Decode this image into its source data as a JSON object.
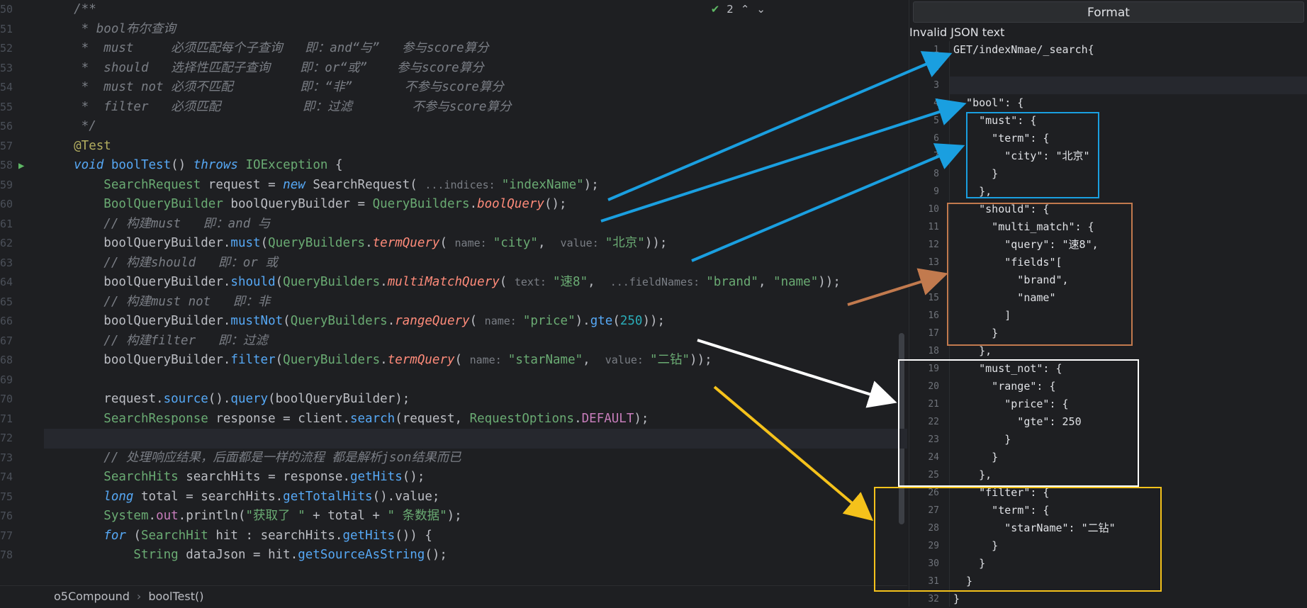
{
  "editor": {
    "inspection_count": "2",
    "lines": [
      {
        "n": "50",
        "tokens": [
          {
            "c": "tok-comment",
            "t": "    /**"
          }
        ]
      },
      {
        "n": "51",
        "tokens": [
          {
            "c": "tok-comment",
            "t": "     * bool布尔查询"
          }
        ]
      },
      {
        "n": "52",
        "tokens": [
          {
            "c": "tok-comment",
            "t": "     *  must     必须匹配每个子查询   即：and“与”   参与score算分"
          }
        ]
      },
      {
        "n": "53",
        "tokens": [
          {
            "c": "tok-comment",
            "t": "     *  should   选择性匹配子查询    即：or“或”    参与score算分"
          }
        ]
      },
      {
        "n": "54",
        "tokens": [
          {
            "c": "tok-comment",
            "t": "     *  must not 必须不匹配         即：“非”       不参与score算分"
          }
        ]
      },
      {
        "n": "55",
        "tokens": [
          {
            "c": "tok-comment",
            "t": "     *  filter   必须匹配           即：过滤        不参与score算分"
          }
        ]
      },
      {
        "n": "56",
        "tokens": [
          {
            "c": "tok-comment",
            "t": "     */"
          }
        ]
      },
      {
        "n": "57",
        "tokens": [
          {
            "c": "tok-ann",
            "t": "    @Test"
          }
        ]
      },
      {
        "n": "58",
        "tokens": [
          {
            "c": "tok-type tok-it",
            "t": "    void "
          },
          {
            "c": "tok-method",
            "t": "boolTest"
          },
          {
            "c": "",
            "t": "() "
          },
          {
            "c": "tok-type tok-it",
            "t": "throws "
          },
          {
            "c": "tok-class",
            "t": "IOException"
          },
          {
            "c": "",
            "t": " {"
          }
        ]
      },
      {
        "n": "59",
        "tokens": [
          {
            "c": "tok-class",
            "t": "        SearchRequest"
          },
          {
            "c": "",
            "t": " request = "
          },
          {
            "c": "tok-type tok-it",
            "t": "new "
          },
          {
            "c": "",
            "t": "SearchRequest( "
          },
          {
            "c": "tok-hint",
            "t": "...indices: "
          },
          {
            "c": "tok-str",
            "t": "\"indexName\""
          },
          {
            "c": "",
            "t": ");"
          }
        ]
      },
      {
        "n": "60",
        "tokens": [
          {
            "c": "tok-class",
            "t": "        BoolQueryBuilder"
          },
          {
            "c": "",
            "t": " boolQueryBuilder = "
          },
          {
            "c": "tok-class",
            "t": "QueryBuilders"
          },
          {
            "c": "",
            "t": "."
          },
          {
            "c": "tok-static",
            "t": "boolQuery"
          },
          {
            "c": "",
            "t": "();"
          }
        ]
      },
      {
        "n": "61",
        "tokens": [
          {
            "c": "tok-comment",
            "t": "        // 构建must   即：and 与"
          }
        ]
      },
      {
        "n": "62",
        "tokens": [
          {
            "c": "",
            "t": "        boolQueryBuilder."
          },
          {
            "c": "tok-method",
            "t": "must"
          },
          {
            "c": "",
            "t": "("
          },
          {
            "c": "tok-class",
            "t": "QueryBuilders"
          },
          {
            "c": "",
            "t": "."
          },
          {
            "c": "tok-static",
            "t": "termQuery"
          },
          {
            "c": "",
            "t": "( "
          },
          {
            "c": "tok-hint",
            "t": "name: "
          },
          {
            "c": "tok-str",
            "t": "\"city\""
          },
          {
            "c": "",
            "t": ",  "
          },
          {
            "c": "tok-hint",
            "t": "value: "
          },
          {
            "c": "tok-str",
            "t": "\"北京\""
          },
          {
            "c": "",
            "t": "));"
          }
        ]
      },
      {
        "n": "63",
        "tokens": [
          {
            "c": "tok-comment",
            "t": "        // 构建should   即：or 或"
          }
        ]
      },
      {
        "n": "64",
        "tokens": [
          {
            "c": "",
            "t": "        boolQueryBuilder."
          },
          {
            "c": "tok-method",
            "t": "should"
          },
          {
            "c": "",
            "t": "("
          },
          {
            "c": "tok-class",
            "t": "QueryBuilders"
          },
          {
            "c": "",
            "t": "."
          },
          {
            "c": "tok-static",
            "t": "multiMatchQuery"
          },
          {
            "c": "",
            "t": "( "
          },
          {
            "c": "tok-hint",
            "t": "text: "
          },
          {
            "c": "tok-str",
            "t": "\"速8\""
          },
          {
            "c": "",
            "t": ",  "
          },
          {
            "c": "tok-hint",
            "t": "...fieldNames: "
          },
          {
            "c": "tok-str",
            "t": "\"brand\""
          },
          {
            "c": "",
            "t": ", "
          },
          {
            "c": "tok-str",
            "t": "\"name\""
          },
          {
            "c": "",
            "t": "));"
          }
        ]
      },
      {
        "n": "65",
        "tokens": [
          {
            "c": "tok-comment",
            "t": "        // 构建must not   即：非"
          }
        ]
      },
      {
        "n": "66",
        "tokens": [
          {
            "c": "",
            "t": "        boolQueryBuilder."
          },
          {
            "c": "tok-method",
            "t": "mustNot"
          },
          {
            "c": "",
            "t": "("
          },
          {
            "c": "tok-class",
            "t": "QueryBuilders"
          },
          {
            "c": "",
            "t": "."
          },
          {
            "c": "tok-static",
            "t": "rangeQuery"
          },
          {
            "c": "",
            "t": "( "
          },
          {
            "c": "tok-hint",
            "t": "name: "
          },
          {
            "c": "tok-str",
            "t": "\"price\""
          },
          {
            "c": "",
            "t": ")."
          },
          {
            "c": "tok-method",
            "t": "gte"
          },
          {
            "c": "",
            "t": "("
          },
          {
            "c": "tok-num",
            "t": "250"
          },
          {
            "c": "",
            "t": "));"
          }
        ]
      },
      {
        "n": "67",
        "tokens": [
          {
            "c": "tok-comment",
            "t": "        // 构建filter   即：过滤"
          }
        ]
      },
      {
        "n": "68",
        "tokens": [
          {
            "c": "",
            "t": "        boolQueryBuilder."
          },
          {
            "c": "tok-method",
            "t": "filter"
          },
          {
            "c": "",
            "t": "("
          },
          {
            "c": "tok-class",
            "t": "QueryBuilders"
          },
          {
            "c": "",
            "t": "."
          },
          {
            "c": "tok-static",
            "t": "termQuery"
          },
          {
            "c": "",
            "t": "( "
          },
          {
            "c": "tok-hint",
            "t": "name: "
          },
          {
            "c": "tok-str",
            "t": "\"starName\""
          },
          {
            "c": "",
            "t": ",  "
          },
          {
            "c": "tok-hint",
            "t": "value: "
          },
          {
            "c": "tok-str",
            "t": "\"二钻\""
          },
          {
            "c": "",
            "t": "));"
          }
        ]
      },
      {
        "n": "69",
        "tokens": []
      },
      {
        "n": "70",
        "tokens": [
          {
            "c": "",
            "t": "        request."
          },
          {
            "c": "tok-method",
            "t": "source"
          },
          {
            "c": "",
            "t": "()."
          },
          {
            "c": "tok-method",
            "t": "query"
          },
          {
            "c": "",
            "t": "(boolQueryBuilder);"
          }
        ]
      },
      {
        "n": "71",
        "tokens": [
          {
            "c": "tok-class",
            "t": "        SearchResponse"
          },
          {
            "c": "",
            "t": " response = client."
          },
          {
            "c": "tok-method",
            "t": "search"
          },
          {
            "c": "",
            "t": "(request, "
          },
          {
            "c": "tok-class",
            "t": "RequestOptions"
          },
          {
            "c": "",
            "t": "."
          },
          {
            "c": "tok-const",
            "t": "DEFAULT"
          },
          {
            "c": "",
            "t": ");"
          }
        ]
      },
      {
        "n": "72",
        "tokens": [],
        "current": true
      },
      {
        "n": "73",
        "tokens": [
          {
            "c": "tok-comment",
            "t": "        // 处理响应结果，后面都是一样的流程 都是解析json结果而已"
          }
        ]
      },
      {
        "n": "74",
        "tokens": [
          {
            "c": "tok-class",
            "t": "        SearchHits"
          },
          {
            "c": "",
            "t": " searchHits = response."
          },
          {
            "c": "tok-method",
            "t": "getHits"
          },
          {
            "c": "",
            "t": "();"
          }
        ]
      },
      {
        "n": "75",
        "tokens": [
          {
            "c": "tok-type tok-it",
            "t": "        long "
          },
          {
            "c": "",
            "t": "total = searchHits."
          },
          {
            "c": "tok-method",
            "t": "getTotalHits"
          },
          {
            "c": "",
            "t": "().value;"
          }
        ]
      },
      {
        "n": "76",
        "tokens": [
          {
            "c": "tok-class",
            "t": "        System"
          },
          {
            "c": "",
            "t": "."
          },
          {
            "c": "tok-field",
            "t": "out"
          },
          {
            "c": "",
            "t": ".println("
          },
          {
            "c": "tok-str",
            "t": "\"获取了 \""
          },
          {
            "c": "",
            "t": " + total + "
          },
          {
            "c": "tok-str",
            "t": "\" 条数据\""
          },
          {
            "c": "",
            "t": ");"
          }
        ]
      },
      {
        "n": "77",
        "tokens": [
          {
            "c": "tok-type tok-it",
            "t": "        for "
          },
          {
            "c": "",
            "t": "("
          },
          {
            "c": "tok-class",
            "t": "SearchHit"
          },
          {
            "c": "",
            "t": " hit : searchHits."
          },
          {
            "c": "tok-method",
            "t": "getHits"
          },
          {
            "c": "",
            "t": "()) {"
          }
        ]
      },
      {
        "n": "78",
        "tokens": [
          {
            "c": "tok-class",
            "t": "            String"
          },
          {
            "c": "",
            "t": " dataJson = hit."
          },
          {
            "c": "tok-method",
            "t": "getSourceAsString"
          },
          {
            "c": "",
            "t": "();"
          }
        ]
      }
    ]
  },
  "breadcrumb": {
    "class_name": "o5Compound",
    "method_name": "boolTest()"
  },
  "json_panel": {
    "format_label": "Format",
    "status": "Invalid JSON text",
    "lines": [
      {
        "n": "1",
        "t": "GET/indexNmae/_search{"
      },
      {
        "n": "2",
        "t": ""
      },
      {
        "n": "3",
        "t": "",
        "current": true
      },
      {
        "n": "4",
        "t": "  \"bool\": {"
      },
      {
        "n": "5",
        "t": "    \"must\": {"
      },
      {
        "n": "6",
        "t": "      \"term\": {"
      },
      {
        "n": "7",
        "t": "        \"city\": \"北京\""
      },
      {
        "n": "8",
        "t": "      }"
      },
      {
        "n": "9",
        "t": "    },"
      },
      {
        "n": "10",
        "t": "    \"should\": {"
      },
      {
        "n": "11",
        "t": "      \"multi_match\": {"
      },
      {
        "n": "12",
        "t": "        \"query\": \"速8\","
      },
      {
        "n": "13",
        "t": "        \"fields\"["
      },
      {
        "n": "14",
        "t": "          \"brand\","
      },
      {
        "n": "15",
        "t": "          \"name\""
      },
      {
        "n": "16",
        "t": "        ]"
      },
      {
        "n": "17",
        "t": "      }"
      },
      {
        "n": "18",
        "t": "    },"
      },
      {
        "n": "19",
        "t": "    \"must_not\": {"
      },
      {
        "n": "20",
        "t": "      \"range\": {"
      },
      {
        "n": "21",
        "t": "        \"price\": {"
      },
      {
        "n": "22",
        "t": "          \"gte\": 250"
      },
      {
        "n": "23",
        "t": "        }"
      },
      {
        "n": "24",
        "t": "      }"
      },
      {
        "n": "25",
        "t": "    },"
      },
      {
        "n": "26",
        "t": "    \"filter\": {"
      },
      {
        "n": "27",
        "t": "      \"term\": {"
      },
      {
        "n": "28",
        "t": "        \"starName\": \"二钻\""
      },
      {
        "n": "29",
        "t": "      }"
      },
      {
        "n": "30",
        "t": "    }"
      },
      {
        "n": "31",
        "t": "  }"
      },
      {
        "n": "32",
        "t": "}"
      }
    ]
  },
  "colors": {
    "arrow_blue": "#1a9fe0",
    "arrow_brown": "#c27a4e",
    "arrow_white": "#ffffff",
    "arrow_yellow": "#f5c21b",
    "box_blue": "#1a9fe0",
    "box_brown": "#c27a4e",
    "box_white": "#ffffff",
    "box_yellow": "#f5c21b"
  }
}
